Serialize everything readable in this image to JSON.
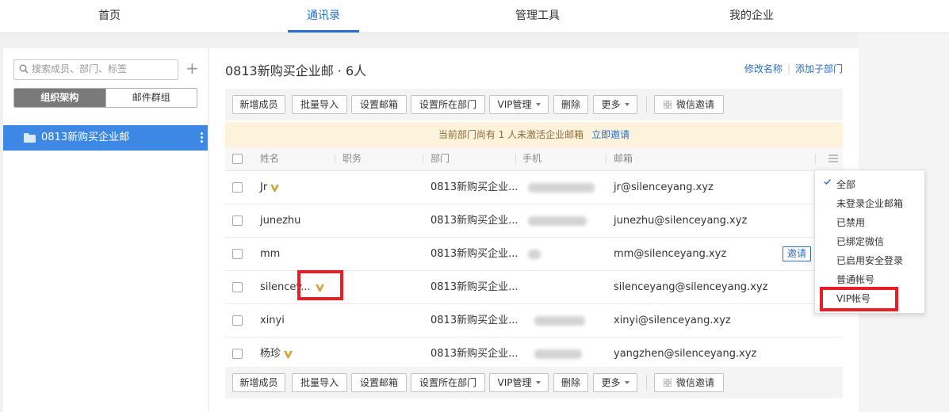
{
  "nav": {
    "tabs": [
      {
        "label": "首页"
      },
      {
        "label": "通讯录"
      },
      {
        "label": "管理工具"
      },
      {
        "label": "我的企业"
      }
    ]
  },
  "sidebar": {
    "search_placeholder": "搜索成员、部门、标签",
    "seg_org": "组织架构",
    "seg_groups": "邮件群组",
    "dept_name": "0813新购买企业邮"
  },
  "main": {
    "title": "0813新购买企业邮 · 6人",
    "rename": "修改名称",
    "add_sub": "添加子部门",
    "notice": "当前部门尚有 1 人未激活企业邮箱",
    "notice_link": "立即邀请"
  },
  "toolbar": {
    "add_member": "新增成员",
    "batch_import": "批量导入",
    "set_email": "设置邮箱",
    "set_dept": "设置所在部门",
    "vip": "VIP管理",
    "delete": "删除",
    "more": "更多",
    "wechat_invite": "微信邀请"
  },
  "table": {
    "headers": {
      "name": "姓名",
      "title": "职务",
      "dept": "部门",
      "phone": "手机",
      "email": "邮箱"
    },
    "rows": [
      {
        "name": "Jr",
        "dept": "0813新购买企业...",
        "email": "jr@silenceyang.xyz"
      },
      {
        "name": "junezhu",
        "dept": "0813新购买企业...",
        "email": "junezhu@silenceyang.xyz"
      },
      {
        "name": "mm",
        "dept": "0813新购买企业...",
        "email": "mm@silenceyang.xyz",
        "invite": "邀请"
      },
      {
        "name": "silencey...",
        "dept": "0813新购买企业...",
        "email": "silenceyang@silenceyang.xyz"
      },
      {
        "name": "xinyi",
        "dept": "0813新购买企业...",
        "email": "xinyi@silenceyang.xyz"
      },
      {
        "name": "杨珍",
        "dept": "0813新购买企业...",
        "email": "yangzhen@silenceyang.xyz"
      }
    ]
  },
  "filter_menu": {
    "options": [
      "全部",
      "未登录企业邮箱",
      "已禁用",
      "已绑定微信",
      "已启用安全登录",
      "普通帐号",
      "VIP帐号"
    ],
    "selected": "全部"
  },
  "colors": {
    "accent": "#2a6fc7",
    "selected_dept": "#3d87e5",
    "vip_gold": "#d4a23a",
    "highlight_red": "#ed1c24",
    "notice_bg": "#fdf2dc"
  },
  "icons": [
    "search-icon",
    "plus-icon",
    "folder-icon",
    "more-vertical-icon",
    "caret-down-icon",
    "grid-icon",
    "vip-crown-icon",
    "column-settings-icon",
    "check-icon"
  ]
}
